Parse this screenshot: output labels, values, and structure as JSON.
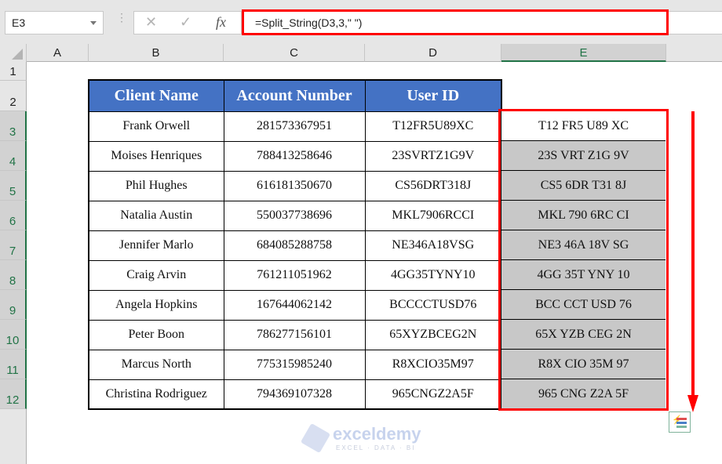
{
  "formula_bar": {
    "name_box": "E3",
    "cancel_icon": "✕",
    "enter_icon": "✓",
    "fx_label": "fx",
    "formula": "=Split_String(D3,3,\" \")"
  },
  "columns": [
    "A",
    "B",
    "C",
    "D",
    "E"
  ],
  "selected_column": "E",
  "rows": [
    "1",
    "2",
    "3",
    "4",
    "5",
    "6",
    "7",
    "8",
    "9",
    "10",
    "11",
    "12"
  ],
  "table": {
    "headers": [
      "Client Name",
      "Account Number",
      "User ID"
    ],
    "rows": [
      [
        "Frank Orwell",
        "281573367951",
        "T12FR5U89XC"
      ],
      [
        "Moises Henriques",
        "788413258646",
        "23SVRTZ1G9V"
      ],
      [
        "Phil Hughes",
        "616181350670",
        "CS56DRT318J"
      ],
      [
        "Natalia Austin",
        "550037738696",
        "MKL7906RCCI"
      ],
      [
        "Jennifer Marlo",
        "684085288758",
        "NE346A18VSG"
      ],
      [
        "Craig Arvin",
        "761211051962",
        "4GG35TYNY10"
      ],
      [
        "Angela Hopkins",
        "167644062142",
        "BCCCCTUSD76"
      ],
      [
        "Peter Boon",
        "786277156101",
        "65XYZBCEG2N"
      ],
      [
        "Marcus North",
        "775315985240",
        "R8XCIO35M97"
      ],
      [
        "Christina Rodriguez",
        "794369107328",
        "965CNGZ2A5F"
      ]
    ]
  },
  "results": [
    "T12 FR5 U89 XC",
    "23S VRT Z1G 9V",
    "CS5 6DR T31 8J",
    "MKL 790 6RC CI",
    "NE3 46A 18V SG",
    "4GG 35T YNY 10",
    "BCC CCT USD 76",
    "65X YZB CEG 2N",
    "R8X CIO 35M 97",
    "965 CNG Z2A 5F"
  ],
  "watermark": {
    "name": "exceldemy",
    "tagline": "EXCEL · DATA · BI"
  },
  "colors": {
    "header_fill": "#4472c4",
    "highlight": "#ff0000",
    "selection": "#217346",
    "result_fill": "#c8c8c8"
  }
}
